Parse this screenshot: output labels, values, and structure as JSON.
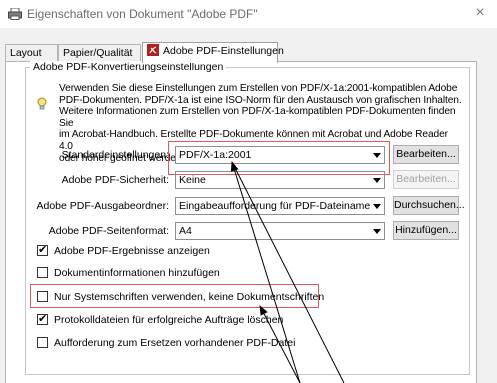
{
  "window": {
    "title": "Eigenschaften von Dokument \"Adobe PDF\"",
    "close_glyph": "×"
  },
  "tabs": [
    {
      "label": "Layout"
    },
    {
      "label": "Papier/Qualität"
    },
    {
      "label": "Adobe PDF-Einstellungen",
      "active": true
    }
  ],
  "group": {
    "legend": "Adobe PDF-Konvertierungseinstellungen",
    "info_lines": [
      "Verwenden Sie diese Einstellungen zum Erstellen von PDF/X-1a:2001-kompatiblen Adobe",
      "PDF-Dokumenten. PDF/X-1a ist eine ISO-Norm für den Austausch von grafischen Inhalten.",
      "Weitere Informationen zum Erstellen von PDF/X-1a-kompatiblen PDF-Dokumenten finden Sie",
      "im Acrobat-Handbuch. Erstellte PDF-Dokumente können mit Acrobat und Adobe Reader 4.0",
      "oder höher geöffnet werden."
    ]
  },
  "fields": {
    "standard": {
      "label": "Standardeinstellungen:",
      "value": "PDF/X-1a:2001",
      "button": "Bearbeiten..."
    },
    "security": {
      "label": "Adobe PDF-Sicherheit:",
      "value": "Keine",
      "button": "Bearbeiten..."
    },
    "output": {
      "label": "Adobe PDF-Ausgabeordner:",
      "value": "Eingabeaufforderung für PDF-Dateiname",
      "button": "Durchsuchen..."
    },
    "pagesize": {
      "label": "Adobe PDF-Seitenformat:",
      "value": "A4",
      "button": "Hinzufügen..."
    }
  },
  "checkboxes": [
    {
      "label": "Adobe PDF-Ergebnisse anzeigen",
      "checked": true
    },
    {
      "label": "Dokumentinformationen hinzufügen",
      "checked": false
    },
    {
      "label": "Nur Systemschriften verwenden, keine Dokumentschriften",
      "checked": false
    },
    {
      "label": "Protokolldateien für erfolgreiche Aufträge löschen",
      "checked": true
    },
    {
      "label": "Aufforderung zum Ersetzen vorhandener PDF-Datei",
      "checked": false
    }
  ],
  "colors": {
    "highlight": "#e05a5a"
  }
}
